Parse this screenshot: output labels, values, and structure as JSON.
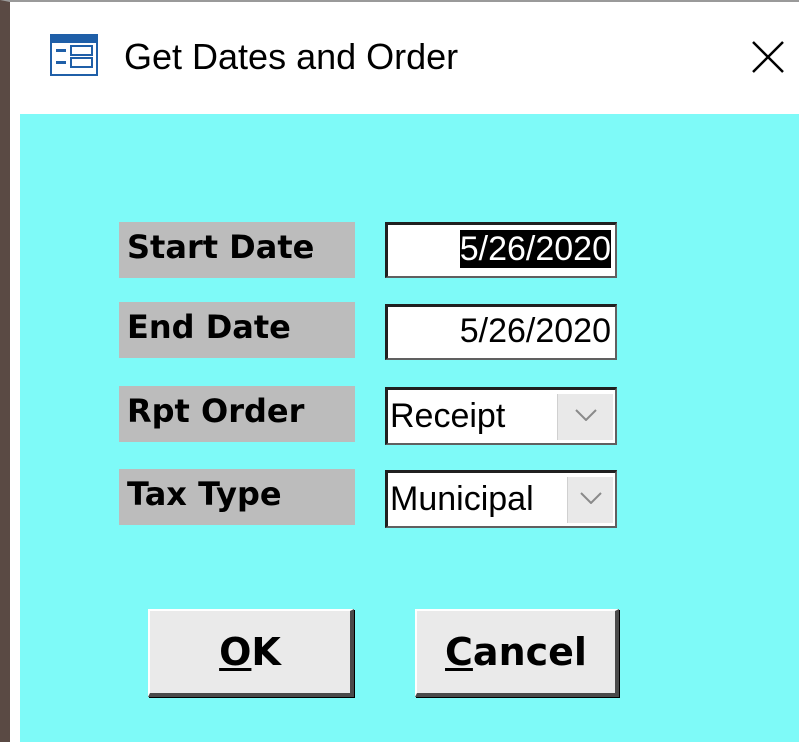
{
  "window": {
    "title": "Get Dates and Order",
    "title_icon": "form-icon",
    "close_icon": "close-icon",
    "client_color": "#7efaf8"
  },
  "form": {
    "start_date": {
      "label": "Start Date",
      "value": "5/26/2020"
    },
    "end_date": {
      "label": "End Date",
      "value": "5/26/2020"
    },
    "rpt_order": {
      "label": "Rpt Order",
      "value": "Receipt"
    },
    "tax_type": {
      "label": "Tax Type",
      "value": "Municipal"
    }
  },
  "buttons": {
    "ok": {
      "mnemonic": "O",
      "rest": "K"
    },
    "cancel": {
      "mnemonic": "C",
      "rest": "ancel"
    }
  }
}
